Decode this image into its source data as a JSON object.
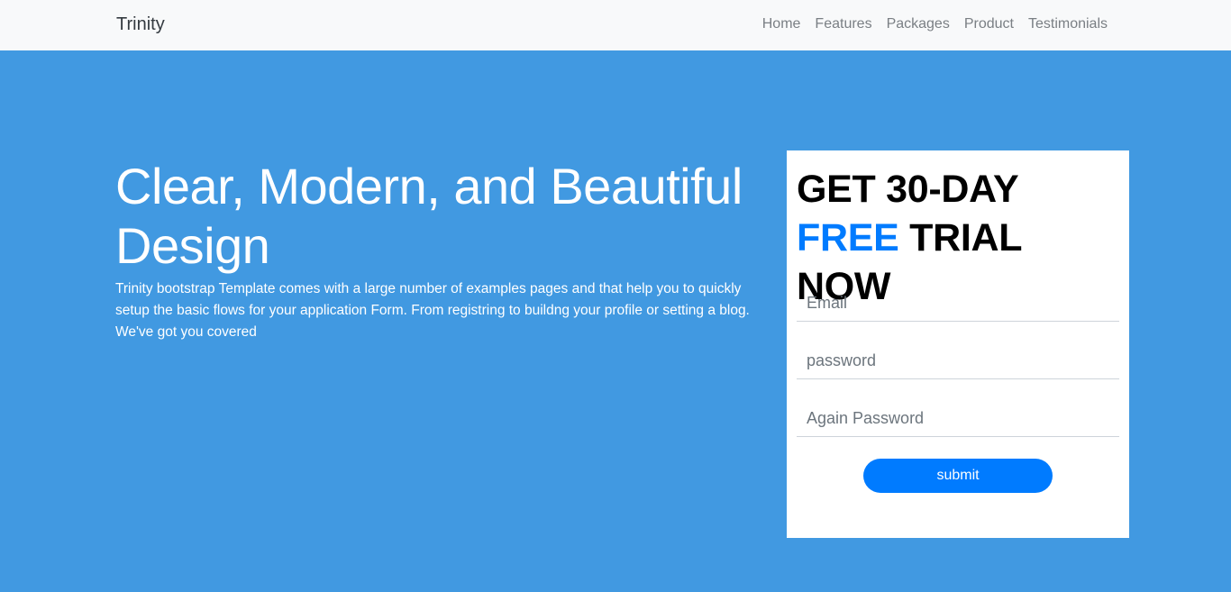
{
  "navbar": {
    "brand": "Trinity",
    "links": [
      "Home",
      "Features",
      "Packages",
      "Product",
      "Testimonials"
    ]
  },
  "hero": {
    "title": "Clear, Modern, and Beautiful Design",
    "text": "Trinity bootstrap Template comes with a large number of examples pages and that help you to quickly setup the basic flows for your application Form. From registring to buildng your profile or setting a blog. We've got you covered"
  },
  "signup": {
    "heading_part1": "GET 30-DAY ",
    "heading_accent": "FREE",
    "heading_part2": " TRIAL NOW",
    "email_placeholder": "Email",
    "password_placeholder": "password",
    "again_password_placeholder": "Again Password",
    "submit_label": "submit"
  },
  "colors": {
    "hero_bg": "#4199e1",
    "accent": "#007bff",
    "navbar_bg": "#f8f9fa"
  }
}
